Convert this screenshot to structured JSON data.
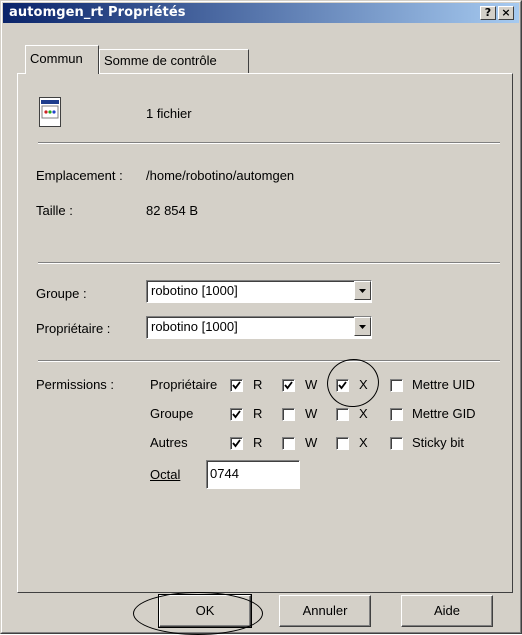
{
  "window": {
    "title": "automgen_rt Propriétés",
    "help_btn": "?",
    "close_btn": "×"
  },
  "tabs": [
    {
      "label": "Commun",
      "active": true
    },
    {
      "label": "Somme de contrôle",
      "active": false
    }
  ],
  "file": {
    "icon": "file-icon",
    "count": "1 fichier"
  },
  "info": {
    "location_label": "Emplacement :",
    "location_value": "/home/robotino/automgen",
    "size_label": "Taille :",
    "size_value": "82 854 B"
  },
  "group": {
    "label": "Groupe :",
    "value": "robotino [1000]"
  },
  "owner": {
    "label": "Propriétaire :",
    "value": "robotino [1000]"
  },
  "permissions": {
    "label": "Permissions :",
    "columns": {
      "r": "R",
      "w": "W",
      "x": "X"
    },
    "rows": [
      {
        "name": "Propriétaire",
        "r": true,
        "w": true,
        "x": true,
        "extra_label": "Mettre UID",
        "extra": false
      },
      {
        "name": "Groupe",
        "r": true,
        "w": false,
        "x": false,
        "extra_label": "Mettre GID",
        "extra": false
      },
      {
        "name": "Autres",
        "r": true,
        "w": false,
        "x": false,
        "extra_label": "Sticky bit",
        "extra": false
      }
    ],
    "octal_label": "Octal",
    "octal_value": "0744"
  },
  "buttons": {
    "ok": "OK",
    "cancel": "Annuler",
    "help": "Aide"
  }
}
